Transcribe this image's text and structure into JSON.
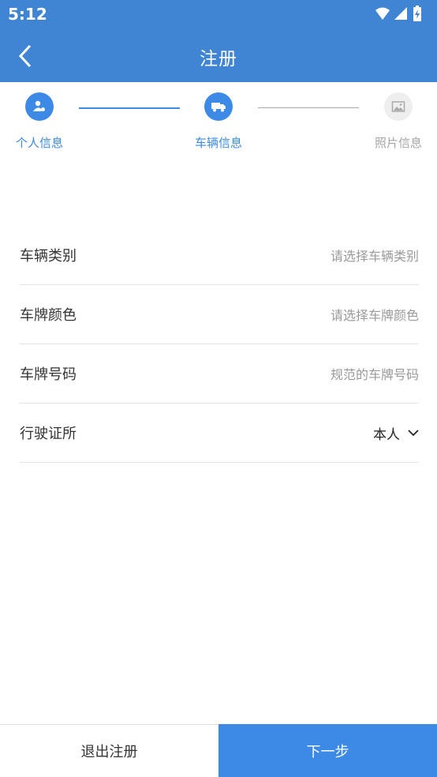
{
  "status": {
    "time": "5:12"
  },
  "appbar": {
    "title": "注册",
    "back_icon": "back-arrow-icon"
  },
  "steps": [
    {
      "label": "个人信息",
      "icon": "person-icon",
      "state": "active"
    },
    {
      "label": "车辆信息",
      "icon": "truck-icon",
      "state": "active"
    },
    {
      "label": "照片信息",
      "icon": "image-icon",
      "state": "inactive"
    }
  ],
  "colors": {
    "primary": "#3d8ae6",
    "statusbar": "#3f85d3",
    "inactive": "#a5a5a5"
  },
  "form": {
    "vehicle_type": {
      "label": "车辆类别",
      "placeholder": "请选择车辆类别"
    },
    "plate_color": {
      "label": "车牌颜色",
      "placeholder": "请选择车牌颜色"
    },
    "plate_number": {
      "label": "车牌号码",
      "placeholder": "规范的车牌号码"
    },
    "license_owner": {
      "label": "行驶证所",
      "value": "本人"
    }
  },
  "buttons": {
    "exit": "退出注册",
    "next": "下一步"
  }
}
